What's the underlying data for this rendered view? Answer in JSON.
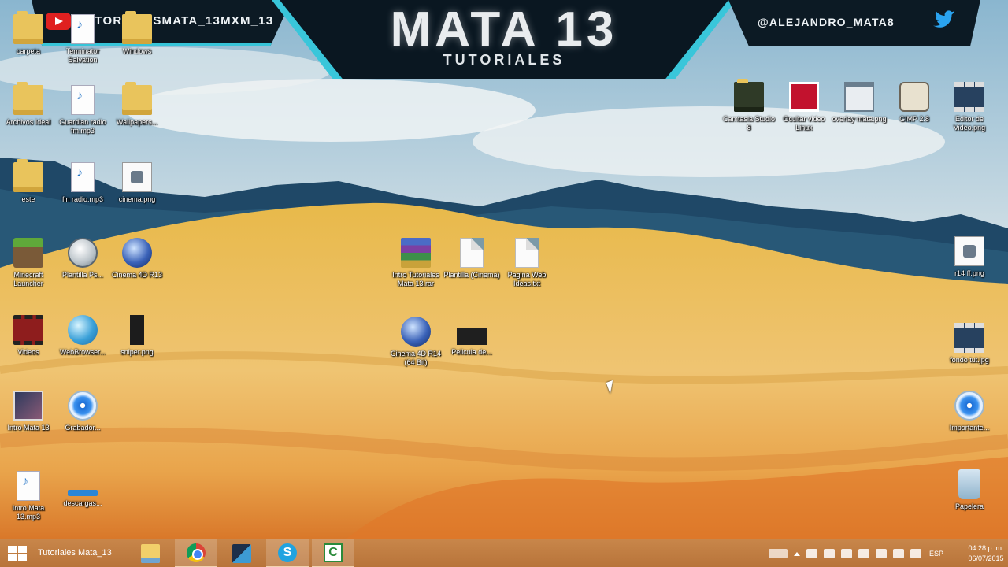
{
  "banner": {
    "channel_left": "TUTORIALESMATA_13MXM_13",
    "title": "MATA 13",
    "subtitle": "TUTORIALES",
    "handle_right": "@ALEJANDRO_MATA8"
  },
  "desktop_icons": [
    {
      "label": "carpeta",
      "icon": "folder-icon"
    },
    {
      "label": "Terminator Salvation",
      "icon": "mp3-icon"
    },
    {
      "label": "Windows",
      "icon": "folder-icon"
    },
    {
      "label": "Archivos Ideal",
      "icon": "folder-icon"
    },
    {
      "label": "Guardian radio fm.mp3",
      "icon": "mp3-icon"
    },
    {
      "label": "Wallpapers...",
      "icon": "folder-icon"
    },
    {
      "label": "este",
      "icon": "folder-icon"
    },
    {
      "label": "fin radio.mp3",
      "icon": "mp3-icon"
    },
    {
      "label": "cinema.png",
      "icon": "png-icon"
    },
    {
      "label": "Minecraft Launcher",
      "icon": "minecraft-icon"
    },
    {
      "label": "Plantilla Ps...",
      "icon": "round-icon"
    },
    {
      "label": "Cinema 4D R13",
      "icon": "c4d-icon"
    },
    {
      "label": "Videos",
      "icon": "video-icon"
    },
    {
      "label": "WebBrowser...",
      "icon": "globe-icon"
    },
    {
      "label": "sniper.png",
      "icon": "dark-png-icon"
    },
    {
      "label": "Intro Mata 13",
      "icon": "photo-icon"
    },
    {
      "label": "Grabador...",
      "icon": "disc-icon"
    },
    {
      "label": "Intro Mata 13.mp3",
      "icon": "mp3-icon"
    },
    {
      "label": "descargas...",
      "icon": "bar-icon"
    },
    {
      "label": "Intro Tutoriales Mata 13.rar",
      "icon": "winrar-icon"
    },
    {
      "label": "Plantilla (Cinema)",
      "icon": "doc-icon"
    },
    {
      "label": "Pagina Web Ideas.txt",
      "icon": "doc-icon"
    },
    {
      "label": "Cinema 4D R14 (64 Bit)",
      "icon": "c4d-icon"
    },
    {
      "label": "Pelicula de...",
      "icon": "dark-pic-icon"
    },
    {
      "label": "Camtasia Studio 8",
      "icon": "dark-folder-icon"
    },
    {
      "label": "Ocultar video Linux",
      "icon": "red-tile-icon"
    },
    {
      "label": "overlay mata.png",
      "icon": "window-icon"
    },
    {
      "label": "GIMP 2.8",
      "icon": "gimp-icon"
    },
    {
      "label": "Editor de Video.png",
      "icon": "film-icon"
    },
    {
      "label": "r14 ff.png",
      "icon": "png-icon"
    },
    {
      "label": "fondo tut.jpg",
      "icon": "film-icon"
    },
    {
      "label": "Importante...",
      "icon": "disc-icon"
    },
    {
      "label": "Papelera",
      "icon": "recycle-bin-icon"
    }
  ],
  "taskbar": {
    "window_title": "Tutoriales Mata_13",
    "apps": [
      "file-explorer",
      "chrome",
      "tool",
      "skype",
      "camtasia"
    ],
    "skype_glyph": "S",
    "camtasia_glyph": "C",
    "lang": "ESP",
    "time": "04:28 p. m.",
    "date": "06/07/2015"
  },
  "colors": {
    "taskbar": "#b8743a",
    "banner_accent": "#39c6da",
    "banner_dark": "#0a1721"
  }
}
